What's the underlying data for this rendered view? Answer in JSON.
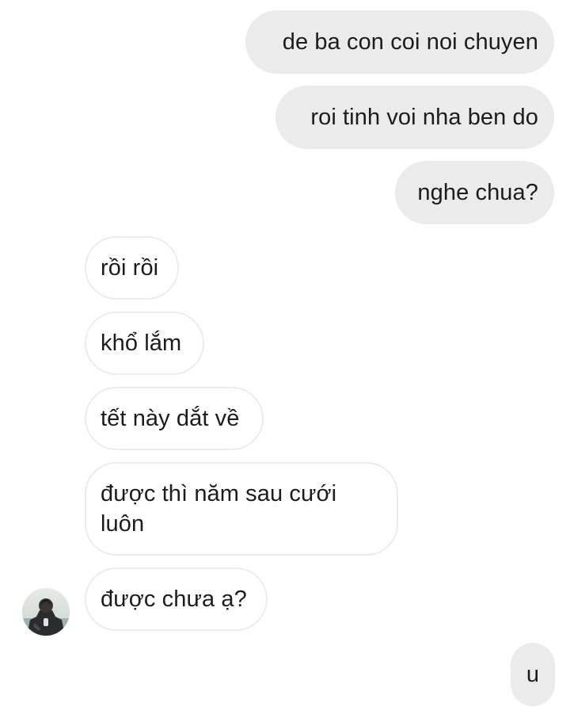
{
  "conversation": {
    "outgoing": [
      {
        "text": "de ba con coi noi chuyen"
      },
      {
        "text": "roi tinh voi nha ben do"
      },
      {
        "text": "nghe chua?"
      }
    ],
    "incoming": [
      {
        "text": "rồi rồi"
      },
      {
        "text": "khổ lắm"
      },
      {
        "text": "tết này dắt về"
      },
      {
        "text": "được thì năm sau cưới luôn"
      },
      {
        "text": "được chưa ạ?"
      }
    ],
    "reply": {
      "text": "u"
    }
  },
  "colors": {
    "outgoing_bubble": "#ebebeb",
    "incoming_border": "#ececec",
    "text": "#1c1c1c",
    "background": "#ffffff"
  },
  "icons": {
    "avatar": "contact-avatar-photo"
  }
}
